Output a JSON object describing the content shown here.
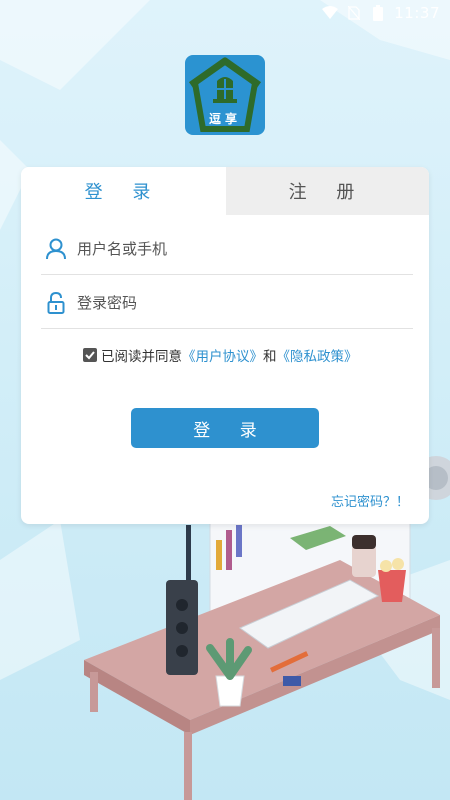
{
  "status_bar": {
    "time": "11:37",
    "icons": [
      "wifi-icon",
      "no-sim-icon",
      "battery-icon"
    ]
  },
  "logo": {
    "text": "逗享",
    "icon": "house-logo-icon",
    "bg_color": "#2b93d1"
  },
  "tabs": [
    {
      "label": "登 录",
      "active": true
    },
    {
      "label": "注 册",
      "active": false
    }
  ],
  "username": {
    "placeholder": "用户名或手机",
    "icon": "user-icon"
  },
  "password": {
    "placeholder": "登录密码",
    "icon": "lock-icon"
  },
  "agreement": {
    "checked": true,
    "text_prefix": "已阅读并同意",
    "user_agreement": "《用户协议》",
    "joiner": "和",
    "privacy_policy": "《隐私政策》"
  },
  "login_button": "登 录",
  "forgot_password": "忘记密码？！",
  "colors": {
    "accent": "#2e91cf",
    "inactive_tab_bg": "#eeeeee",
    "background": "#d2eef8"
  }
}
